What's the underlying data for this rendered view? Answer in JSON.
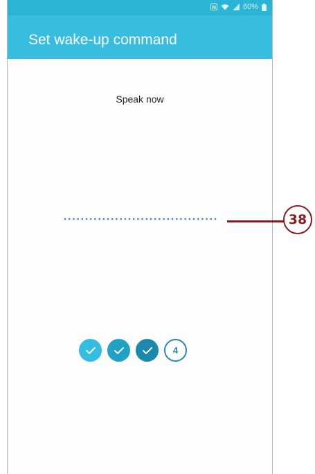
{
  "status_bar": {
    "battery_percent": "60%",
    "icons": [
      "nfc-icon",
      "wifi-icon",
      "signal-icon",
      "battery-icon"
    ]
  },
  "app_bar": {
    "title": "Set wake-up command"
  },
  "content": {
    "prompt": "Speak now",
    "steps": [
      {
        "state": "done",
        "icon": "check-icon",
        "color": "#33bde0"
      },
      {
        "state": "done",
        "icon": "check-icon",
        "color": "#1fa2c6"
      },
      {
        "state": "done",
        "icon": "check-icon",
        "color": "#1b88ae"
      },
      {
        "state": "current",
        "label": "4"
      }
    ]
  },
  "callout": {
    "number": "38",
    "color": "#8b1a1f"
  },
  "colors": {
    "status_bar": "#2ab4d6",
    "app_bar": "#37bde0",
    "waveform_dots": "#4a7fb0"
  }
}
